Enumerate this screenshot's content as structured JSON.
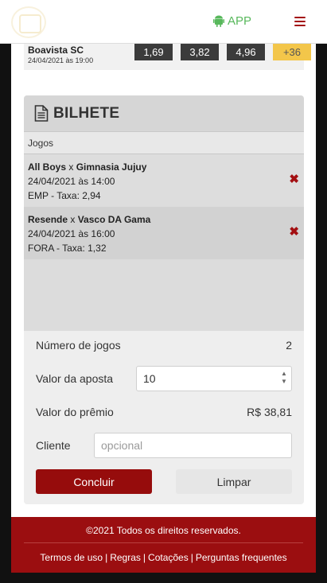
{
  "header": {
    "app_label": "APP"
  },
  "match": {
    "team": "Boavista SC",
    "datetime": "24/04/2021 às 19:00",
    "odds": [
      "1,69",
      "3,82",
      "4,96"
    ],
    "more": "+36"
  },
  "ticket": {
    "title": "BILHETE",
    "games_header": "Jogos",
    "bets": [
      {
        "home": "All Boys",
        "vs": "x",
        "away": "Gimnasia Jujuy",
        "datetime": "24/04/2021 às 14:00",
        "pick": "EMP - Taxa: 2,94"
      },
      {
        "home": "Resende",
        "vs": "x",
        "away": "Vasco DA Gama",
        "datetime": "24/04/2021 às 16:00",
        "pick": "FORA - Taxa: 1,32"
      }
    ],
    "num_games_label": "Número de jogos",
    "num_games_value": "2",
    "stake_label": "Valor da aposta",
    "stake_value": "10",
    "prize_label": "Valor do prêmio",
    "prize_value": "R$ 38,81",
    "client_label": "Cliente",
    "client_placeholder": "opcional",
    "conclude_label": "Concluir",
    "clear_label": "Limpar"
  },
  "footer": {
    "copyright": "©2021 Todos os direitos reservados.",
    "links": [
      "Termos de uso",
      "Regras",
      "Cotações",
      "Perguntas frequentes"
    ]
  },
  "colors": {
    "brand": "#9b0e10",
    "android": "#58b85c",
    "highlight": "#f3c64a"
  }
}
